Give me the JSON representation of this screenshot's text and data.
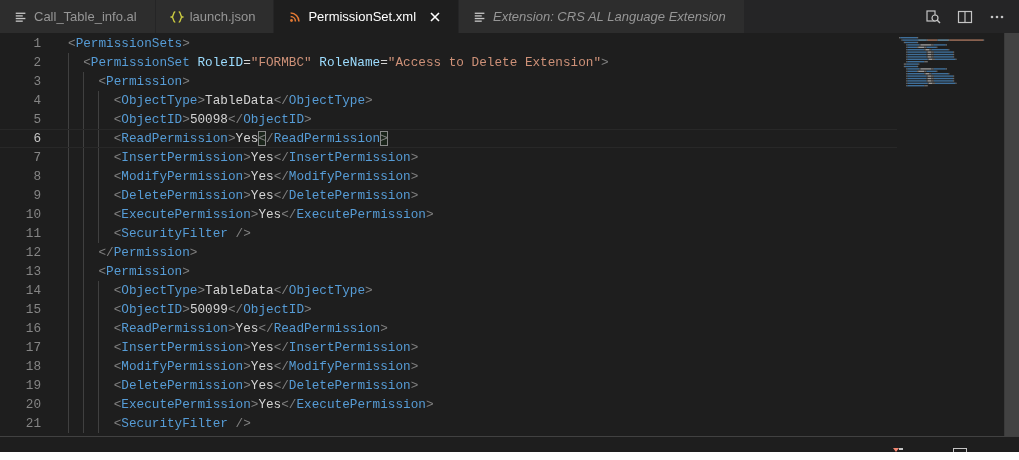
{
  "tabs": [
    {
      "label": "Call_Table_info.al",
      "kind": "text",
      "selected": false,
      "preview": false
    },
    {
      "label": "launch.json",
      "kind": "json",
      "selected": false,
      "preview": false
    },
    {
      "label": "PermissionSet.xml",
      "kind": "xml",
      "selected": true,
      "preview": false
    },
    {
      "label": "Extension: CRS AL Language Extension",
      "kind": "text",
      "selected": false,
      "preview": true
    }
  ],
  "lines": [
    {
      "number": "1",
      "current": false,
      "tokens": [
        {
          "kind": "punct",
          "text": "<"
        },
        {
          "kind": "tag",
          "text": "PermissionSets"
        },
        {
          "kind": "punct",
          "text": ">"
        }
      ],
      "children": [
        {
          "number": "2",
          "current": false,
          "tokens": [
            {
              "kind": "punct",
              "text": "<"
            },
            {
              "kind": "tag",
              "text": "PermissionSet"
            },
            {
              "kind": "attr",
              "text": " RoleID"
            },
            {
              "kind": "plain",
              "text": "="
            },
            {
              "kind": "string",
              "text": "\"FORMBC\""
            },
            {
              "kind": "attr",
              "text": " RoleName"
            },
            {
              "kind": "plain",
              "text": "="
            },
            {
              "kind": "string",
              "text": "\"Access to Delete Extension\""
            },
            {
              "kind": "punct",
              "text": ">"
            }
          ],
          "children": [
            {
              "number": "3",
              "current": false,
              "tokens": [
                {
                  "kind": "punct",
                  "text": "<"
                },
                {
                  "kind": "tag",
                  "text": "Permission"
                },
                {
                  "kind": "punct",
                  "text": ">"
                }
              ],
              "children": [
                {
                  "number": "4",
                  "current": false,
                  "tokens": [
                    {
                      "kind": "punct",
                      "text": "<"
                    },
                    {
                      "kind": "tag",
                      "text": "ObjectType"
                    },
                    {
                      "kind": "punct",
                      "text": ">"
                    },
                    {
                      "kind": "plain",
                      "text": "TableData"
                    },
                    {
                      "kind": "punct",
                      "text": "</"
                    },
                    {
                      "kind": "tag",
                      "text": "ObjectType"
                    },
                    {
                      "kind": "punct",
                      "text": ">"
                    }
                  ]
                },
                {
                  "number": "5",
                  "current": false,
                  "tokens": [
                    {
                      "kind": "punct",
                      "text": "<"
                    },
                    {
                      "kind": "tag",
                      "text": "ObjectID"
                    },
                    {
                      "kind": "punct",
                      "text": ">"
                    },
                    {
                      "kind": "plain",
                      "text": "50098"
                    },
                    {
                      "kind": "punct",
                      "text": "</"
                    },
                    {
                      "kind": "tag",
                      "text": "ObjectID"
                    },
                    {
                      "kind": "punct",
                      "text": ">"
                    }
                  ]
                },
                {
                  "number": "6",
                  "current": true,
                  "tokens": [
                    {
                      "kind": "punct",
                      "text": "<"
                    },
                    {
                      "kind": "tag",
                      "text": "ReadPermission"
                    },
                    {
                      "kind": "punct",
                      "text": ">"
                    },
                    {
                      "kind": "plain",
                      "text": "Yes"
                    },
                    {
                      "kind": "punct",
                      "text": "<",
                      "matched": true
                    },
                    {
                      "kind": "punct",
                      "text": "/"
                    },
                    {
                      "kind": "tag",
                      "text": "ReadPermission"
                    },
                    {
                      "kind": "punct",
                      "text": ">",
                      "matched": true
                    }
                  ]
                },
                {
                  "number": "7",
                  "current": false,
                  "tokens": [
                    {
                      "kind": "punct",
                      "text": "<"
                    },
                    {
                      "kind": "tag",
                      "text": "InsertPermission"
                    },
                    {
                      "kind": "punct",
                      "text": ">"
                    },
                    {
                      "kind": "plain",
                      "text": "Yes"
                    },
                    {
                      "kind": "punct",
                      "text": "</"
                    },
                    {
                      "kind": "tag",
                      "text": "InsertPermission"
                    },
                    {
                      "kind": "punct",
                      "text": ">"
                    }
                  ]
                },
                {
                  "number": "8",
                  "current": false,
                  "tokens": [
                    {
                      "kind": "punct",
                      "text": "<"
                    },
                    {
                      "kind": "tag",
                      "text": "ModifyPermission"
                    },
                    {
                      "kind": "punct",
                      "text": ">"
                    },
                    {
                      "kind": "plain",
                      "text": "Yes"
                    },
                    {
                      "kind": "punct",
                      "text": "</"
                    },
                    {
                      "kind": "tag",
                      "text": "ModifyPermission"
                    },
                    {
                      "kind": "punct",
                      "text": ">"
                    }
                  ]
                },
                {
                  "number": "9",
                  "current": false,
                  "tokens": [
                    {
                      "kind": "punct",
                      "text": "<"
                    },
                    {
                      "kind": "tag",
                      "text": "DeletePermission"
                    },
                    {
                      "kind": "punct",
                      "text": ">"
                    },
                    {
                      "kind": "plain",
                      "text": "Yes"
                    },
                    {
                      "kind": "punct",
                      "text": "</"
                    },
                    {
                      "kind": "tag",
                      "text": "DeletePermission"
                    },
                    {
                      "kind": "punct",
                      "text": ">"
                    }
                  ]
                },
                {
                  "number": "10",
                  "current": false,
                  "tokens": [
                    {
                      "kind": "punct",
                      "text": "<"
                    },
                    {
                      "kind": "tag",
                      "text": "ExecutePermission"
                    },
                    {
                      "kind": "punct",
                      "text": ">"
                    },
                    {
                      "kind": "plain",
                      "text": "Yes"
                    },
                    {
                      "kind": "punct",
                      "text": "</"
                    },
                    {
                      "kind": "tag",
                      "text": "ExecutePermission"
                    },
                    {
                      "kind": "punct",
                      "text": ">"
                    }
                  ]
                },
                {
                  "number": "11",
                  "current": false,
                  "tokens": [
                    {
                      "kind": "punct",
                      "text": "<"
                    },
                    {
                      "kind": "tag",
                      "text": "SecurityFilter"
                    },
                    {
                      "kind": "punct",
                      "text": " />"
                    }
                  ]
                }
              ]
            },
            {
              "number": "12",
              "current": false,
              "tokens": [
                {
                  "kind": "punct",
                  "text": "</"
                },
                {
                  "kind": "tag",
                  "text": "Permission"
                },
                {
                  "kind": "punct",
                  "text": ">"
                }
              ]
            },
            {
              "number": "13",
              "current": false,
              "tokens": [
                {
                  "kind": "punct",
                  "text": "<"
                },
                {
                  "kind": "tag",
                  "text": "Permission"
                },
                {
                  "kind": "punct",
                  "text": ">"
                }
              ],
              "children": [
                {
                  "number": "14",
                  "current": false,
                  "tokens": [
                    {
                      "kind": "punct",
                      "text": "<"
                    },
                    {
                      "kind": "tag",
                      "text": "ObjectType"
                    },
                    {
                      "kind": "punct",
                      "text": ">"
                    },
                    {
                      "kind": "plain",
                      "text": "TableData"
                    },
                    {
                      "kind": "punct",
                      "text": "</"
                    },
                    {
                      "kind": "tag",
                      "text": "ObjectType"
                    },
                    {
                      "kind": "punct",
                      "text": ">"
                    }
                  ]
                },
                {
                  "number": "15",
                  "current": false,
                  "tokens": [
                    {
                      "kind": "punct",
                      "text": "<"
                    },
                    {
                      "kind": "tag",
                      "text": "ObjectID"
                    },
                    {
                      "kind": "punct",
                      "text": ">"
                    },
                    {
                      "kind": "plain",
                      "text": "50099"
                    },
                    {
                      "kind": "punct",
                      "text": "</"
                    },
                    {
                      "kind": "tag",
                      "text": "ObjectID"
                    },
                    {
                      "kind": "punct",
                      "text": ">"
                    }
                  ]
                },
                {
                  "number": "16",
                  "current": false,
                  "tokens": [
                    {
                      "kind": "punct",
                      "text": "<"
                    },
                    {
                      "kind": "tag",
                      "text": "ReadPermission"
                    },
                    {
                      "kind": "punct",
                      "text": ">"
                    },
                    {
                      "kind": "plain",
                      "text": "Yes"
                    },
                    {
                      "kind": "punct",
                      "text": "</"
                    },
                    {
                      "kind": "tag",
                      "text": "ReadPermission"
                    },
                    {
                      "kind": "punct",
                      "text": ">"
                    }
                  ]
                },
                {
                  "number": "17",
                  "current": false,
                  "tokens": [
                    {
                      "kind": "punct",
                      "text": "<"
                    },
                    {
                      "kind": "tag",
                      "text": "InsertPermission"
                    },
                    {
                      "kind": "punct",
                      "text": ">"
                    },
                    {
                      "kind": "plain",
                      "text": "Yes"
                    },
                    {
                      "kind": "punct",
                      "text": "</"
                    },
                    {
                      "kind": "tag",
                      "text": "InsertPermission"
                    },
                    {
                      "kind": "punct",
                      "text": ">"
                    }
                  ]
                },
                {
                  "number": "18",
                  "current": false,
                  "tokens": [
                    {
                      "kind": "punct",
                      "text": "<"
                    },
                    {
                      "kind": "tag",
                      "text": "ModifyPermission"
                    },
                    {
                      "kind": "punct",
                      "text": ">"
                    },
                    {
                      "kind": "plain",
                      "text": "Yes"
                    },
                    {
                      "kind": "punct",
                      "text": "</"
                    },
                    {
                      "kind": "tag",
                      "text": "ModifyPermission"
                    },
                    {
                      "kind": "punct",
                      "text": ">"
                    }
                  ]
                },
                {
                  "number": "19",
                  "current": false,
                  "tokens": [
                    {
                      "kind": "punct",
                      "text": "<"
                    },
                    {
                      "kind": "tag",
                      "text": "DeletePermission"
                    },
                    {
                      "kind": "punct",
                      "text": ">"
                    },
                    {
                      "kind": "plain",
                      "text": "Yes"
                    },
                    {
                      "kind": "punct",
                      "text": "</"
                    },
                    {
                      "kind": "tag",
                      "text": "DeletePermission"
                    },
                    {
                      "kind": "punct",
                      "text": ">"
                    }
                  ]
                },
                {
                  "number": "20",
                  "current": false,
                  "tokens": [
                    {
                      "kind": "punct",
                      "text": "<"
                    },
                    {
                      "kind": "tag",
                      "text": "ExecutePermission"
                    },
                    {
                      "kind": "punct",
                      "text": ">"
                    },
                    {
                      "kind": "plain",
                      "text": "Yes"
                    },
                    {
                      "kind": "punct",
                      "text": "</"
                    },
                    {
                      "kind": "tag",
                      "text": "ExecutePermission"
                    },
                    {
                      "kind": "punct",
                      "text": ">"
                    }
                  ]
                },
                {
                  "number": "21",
                  "current": false,
                  "tokens": [
                    {
                      "kind": "punct",
                      "text": "<"
                    },
                    {
                      "kind": "tag",
                      "text": "SecurityFilter"
                    },
                    {
                      "kind": "punct",
                      "text": " />"
                    }
                  ]
                }
              ]
            }
          ]
        }
      ]
    }
  ]
}
